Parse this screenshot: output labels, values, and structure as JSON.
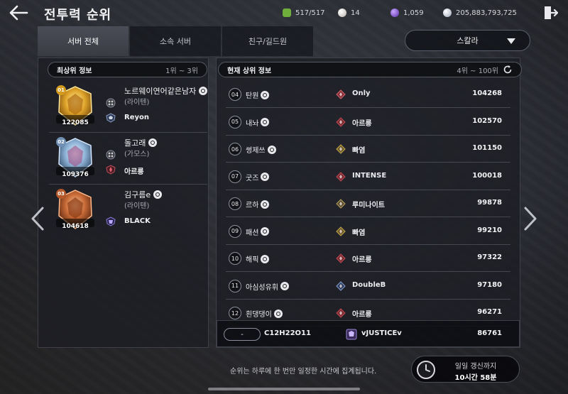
{
  "header": {
    "title": "전투력 순위",
    "resources": [
      {
        "icon": "green-stone-icon",
        "value": "517/517"
      },
      {
        "icon": "pearl-icon",
        "value": "14"
      },
      {
        "icon": "purple-orb-icon",
        "value": "1,059"
      },
      {
        "icon": "silver-coin-icon",
        "value": "205,883,793,725"
      }
    ]
  },
  "tabs": [
    {
      "label": "서버 전체",
      "active": true
    },
    {
      "label": "소속 서버",
      "active": false
    },
    {
      "label": "친구/길드원",
      "active": false
    }
  ],
  "server_select": {
    "value": "스칼라"
  },
  "top_panel": {
    "title": "최상위 정보",
    "range": "1위 ~ 3위",
    "entries": [
      {
        "rank": "01",
        "score": "122085",
        "name": "노르웨이연어같은남자",
        "server": "(라이텐)",
        "guild": "Reyon",
        "tier": "gold"
      },
      {
        "rank": "02",
        "score": "109376",
        "name": "돌고래",
        "server": "(가모스)",
        "guild": "아르릉",
        "tier": "silver"
      },
      {
        "rank": "03",
        "score": "104618",
        "name": "김구름e",
        "server": "(라이텐)",
        "guild": "BLACK",
        "tier": "bronze"
      }
    ]
  },
  "list_panel": {
    "title": "현재 상위 정보",
    "range": "4위 ~ 100위",
    "rows": [
      {
        "rank": "04",
        "name": "탄원",
        "guild": "Only",
        "score": "104268"
      },
      {
        "rank": "05",
        "name": "내놔",
        "guild": "아르릉",
        "score": "102570"
      },
      {
        "rank": "06",
        "name": "썽제쓰",
        "guild": "빠염",
        "score": "101150"
      },
      {
        "rank": "07",
        "name": "굿즈",
        "guild": "INTENSE",
        "score": "100018"
      },
      {
        "rank": "08",
        "name": "르하",
        "guild": "루미나이트",
        "score": "99878"
      },
      {
        "rank": "09",
        "name": "패션",
        "guild": "빠염",
        "score": "99210"
      },
      {
        "rank": "10",
        "name": "해픽",
        "guild": "아르릉",
        "score": "97322"
      },
      {
        "rank": "11",
        "name": "아심성유휘",
        "guild": "DoubleB",
        "score": "97180"
      },
      {
        "rank": "12",
        "name": "흰댕댕이",
        "guild": "아르릉",
        "score": "96271"
      }
    ]
  },
  "my_rank": {
    "rank": "-",
    "name": "C12H22O11",
    "guild": "vJUSTICEv",
    "score": "86761"
  },
  "footer": {
    "notice": "순위는 하루에 한 번만 일정한 시간에 집계됩니다.",
    "timer_label": "일일 갱신까지",
    "timer_value": "10시간 58분"
  }
}
